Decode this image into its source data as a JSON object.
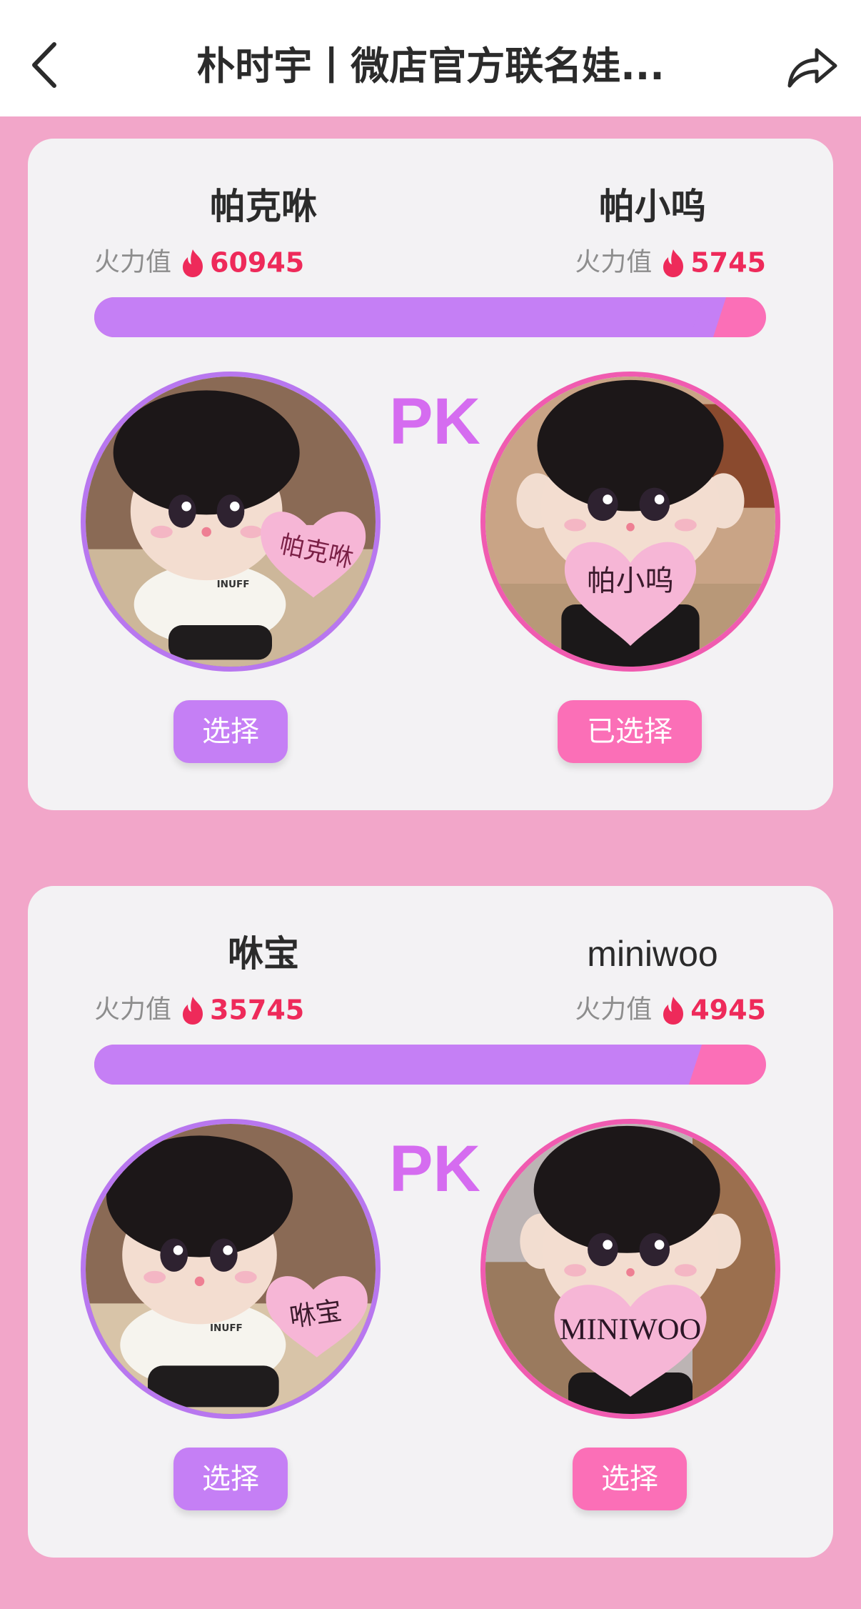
{
  "header": {
    "title": "朴时宇丨微店官方联名娃..."
  },
  "pk_label": "PK",
  "fire_label": "火力值",
  "battles": [
    {
      "left": {
        "name": "帕克咻",
        "fire": "60945",
        "button": "选择",
        "heart_text": "帕克咻",
        "shirt_text": "INUFF"
      },
      "right": {
        "name": "帕小呜",
        "fire": "5745",
        "button": "已选择",
        "heart_text": "帕小呜"
      },
      "left_share": 0.914
    },
    {
      "left": {
        "name": "咻宝",
        "fire": "35745",
        "button": "选择",
        "heart_text": "咻宝",
        "shirt_text": "INUFF"
      },
      "right": {
        "name": "miniwoo",
        "fire": "4945",
        "button": "选择",
        "heart_text": "MINIWOO"
      },
      "left_share": 0.878
    }
  ],
  "colors": {
    "page_bg": "#f2a6c9",
    "purple": "#c57ff5",
    "pink": "#fb6fb7",
    "fire_red": "#ee2a5a",
    "pk": "#d56cf0"
  }
}
